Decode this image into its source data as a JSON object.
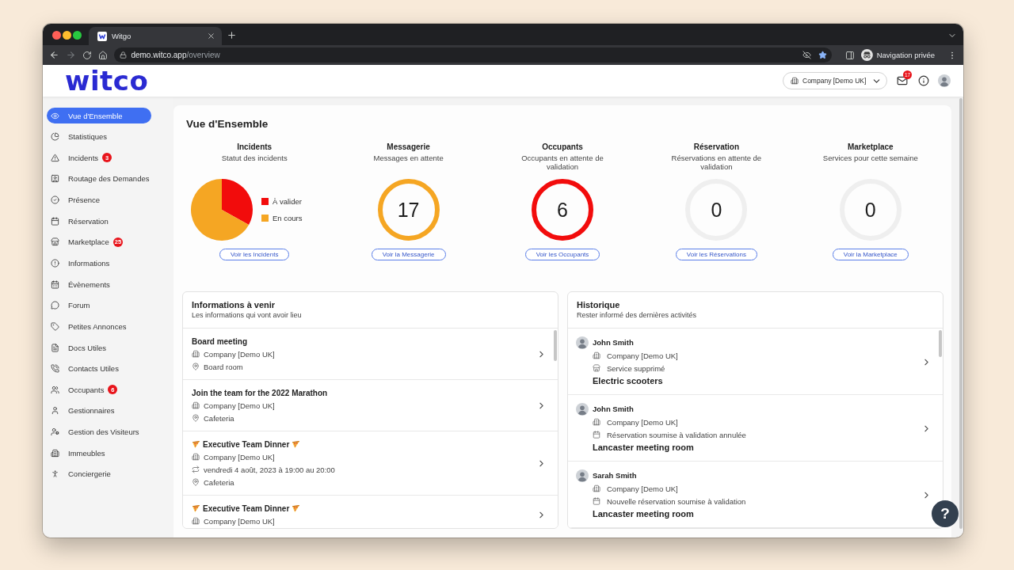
{
  "browser": {
    "tabs": [
      {
        "title": "Witgo",
        "selected": true
      }
    ],
    "url": {
      "host": "demo.witco.app",
      "path": "/overview"
    },
    "profile": "Navigation privée"
  },
  "header": {
    "logo": "witco",
    "company_select": {
      "value": "Company [Demo UK]"
    },
    "mail_badge": "17"
  },
  "sidebar": {
    "items": [
      {
        "label": "Vue d'Ensemble",
        "selected": true
      },
      {
        "label": "Statistiques",
        "selected": false
      },
      {
        "label": "Incidents",
        "selected": false,
        "badge": "3"
      },
      {
        "label": "Routage des Demandes",
        "selected": false
      },
      {
        "label": "Présence",
        "selected": false
      },
      {
        "label": "Réservation",
        "selected": false
      },
      {
        "label": "Marketplace",
        "selected": false,
        "badge": "25"
      },
      {
        "label": "Informations",
        "selected": false
      },
      {
        "label": "Évènements",
        "selected": false
      },
      {
        "label": "Forum",
        "selected": false
      },
      {
        "label": "Petites Annonces",
        "selected": false
      },
      {
        "label": "Docs Utiles",
        "selected": false
      },
      {
        "label": "Contacts Utiles",
        "selected": false
      },
      {
        "label": "Occupants",
        "selected": false,
        "badge": "6"
      },
      {
        "label": "Gestionnaires",
        "selected": false
      },
      {
        "label": "Gestion des Visiteurs",
        "selected": false
      },
      {
        "label": "Immeubles",
        "selected": false
      },
      {
        "label": "Conciergerie",
        "selected": false
      }
    ]
  },
  "overview": {
    "title": "Vue d'Ensemble",
    "stats": [
      {
        "kind": "pie",
        "title": "Incidents",
        "subtitle": "Statut des incidents",
        "legend": [
          {
            "label": "À valider",
            "color": "#f20c0c"
          },
          {
            "label": "En cours",
            "color": "#f5a623"
          }
        ],
        "button": "Voir les Incidents"
      },
      {
        "kind": "ring",
        "title": "Messagerie",
        "subtitle": "Messages en attente",
        "value": "17",
        "color": "#f5a623",
        "button": "Voir la Messagerie"
      },
      {
        "kind": "ring",
        "title": "Occupants",
        "subtitle": "Occupants en attente de validation",
        "value": "6",
        "color": "#f20c0c",
        "button": "Voir les Occupants"
      },
      {
        "kind": "ring",
        "title": "Réservation",
        "subtitle": "Réservations en attente de validation",
        "value": "0",
        "color": "#efefef",
        "button": "Voir les Réservations"
      },
      {
        "kind": "ring",
        "title": "Marketplace",
        "subtitle": "Services pour cette semaine",
        "value": "0",
        "color": "#efefef",
        "button": "Voir la Marketplace"
      }
    ]
  },
  "upcoming": {
    "title": "Informations à venir",
    "subtitle": "Les informations qui vont avoir lieu",
    "items": [
      {
        "title": "Board meeting",
        "decorated": false,
        "lines": [
          {
            "kind": "company",
            "text": "Company [Demo UK]"
          },
          {
            "kind": "place",
            "text": "Board room"
          }
        ]
      },
      {
        "title": "Join the team for the 2022 Marathon",
        "decorated": false,
        "lines": [
          {
            "kind": "company",
            "text": "Company [Demo UK]"
          },
          {
            "kind": "place",
            "text": "Cafeteria"
          }
        ]
      },
      {
        "title": "Executive Team Dinner",
        "decorated": true,
        "lines": [
          {
            "kind": "company",
            "text": "Company [Demo UK]"
          },
          {
            "kind": "schedule",
            "text": "vendredi 4 août, 2023 à 19:00 au 20:00"
          },
          {
            "kind": "place",
            "text": "Cafeteria"
          }
        ]
      },
      {
        "title": "Executive Team Dinner",
        "decorated": true,
        "lines": [
          {
            "kind": "company",
            "text": "Company [Demo UK]"
          }
        ]
      }
    ]
  },
  "history": {
    "title": "Historique",
    "subtitle": "Rester informé des dernières activités",
    "items": [
      {
        "author": "John Smith",
        "lines": [
          {
            "kind": "company",
            "text": "Company [Demo UK]"
          },
          {
            "kind": "service",
            "text": "Service supprimé"
          }
        ],
        "subject": "Electric scooters"
      },
      {
        "author": "John Smith",
        "lines": [
          {
            "kind": "company",
            "text": "Company [Demo UK]"
          },
          {
            "kind": "booking",
            "text": "Réservation soumise à validation annulée"
          }
        ],
        "subject": "Lancaster meeting room"
      },
      {
        "author": "Sarah Smith",
        "lines": [
          {
            "kind": "company",
            "text": "Company [Demo UK]"
          },
          {
            "kind": "booking",
            "text": "Nouvelle réservation soumise à validation"
          }
        ],
        "subject": "Lancaster meeting room"
      }
    ]
  },
  "help_button": "?"
}
